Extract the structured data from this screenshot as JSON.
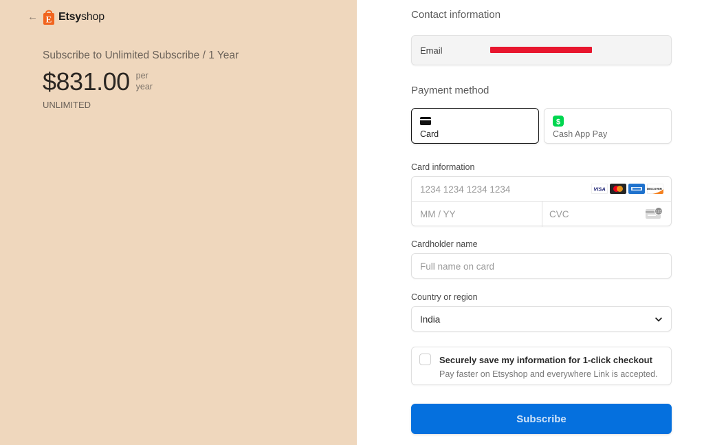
{
  "brand": {
    "name_bold": "Etsy",
    "name_rest": "shop",
    "logo_letter": "E",
    "logo_color": "#f1641e"
  },
  "summary": {
    "title": "Subscribe to Unlimited Subscribe / 1 Year",
    "price": "$831.00",
    "period_line1": "per",
    "period_line2": "year",
    "plan": "UNLIMITED"
  },
  "contact": {
    "heading": "Contact information",
    "email_label": "Email"
  },
  "payment": {
    "heading": "Payment method",
    "methods": [
      {
        "label": "Card",
        "selected": true,
        "icon": "card-icon"
      },
      {
        "label": "Cash App Pay",
        "selected": false,
        "icon": "cash-app-icon"
      }
    ]
  },
  "card_info": {
    "label": "Card information",
    "number_placeholder": "1234 1234 1234 1234",
    "expiry_placeholder": "MM / YY",
    "cvc_placeholder": "CVC",
    "brands": [
      "VISA",
      "mastercard",
      "amex",
      "DISCOVER"
    ]
  },
  "cardholder": {
    "label": "Cardholder name",
    "placeholder": "Full name on card"
  },
  "country": {
    "label": "Country or region",
    "value": "India"
  },
  "save_info": {
    "title": "Securely save my information for 1-click checkout",
    "description": "Pay faster on Etsyshop and everywhere Link is accepted.",
    "checked": false
  },
  "submit": {
    "label": "Subscribe",
    "color": "#0570de"
  },
  "colors": {
    "left_panel": "#efd7bd",
    "accent": "#0570de",
    "cash_app": "#00d64f",
    "redaction": "#e8162e"
  }
}
